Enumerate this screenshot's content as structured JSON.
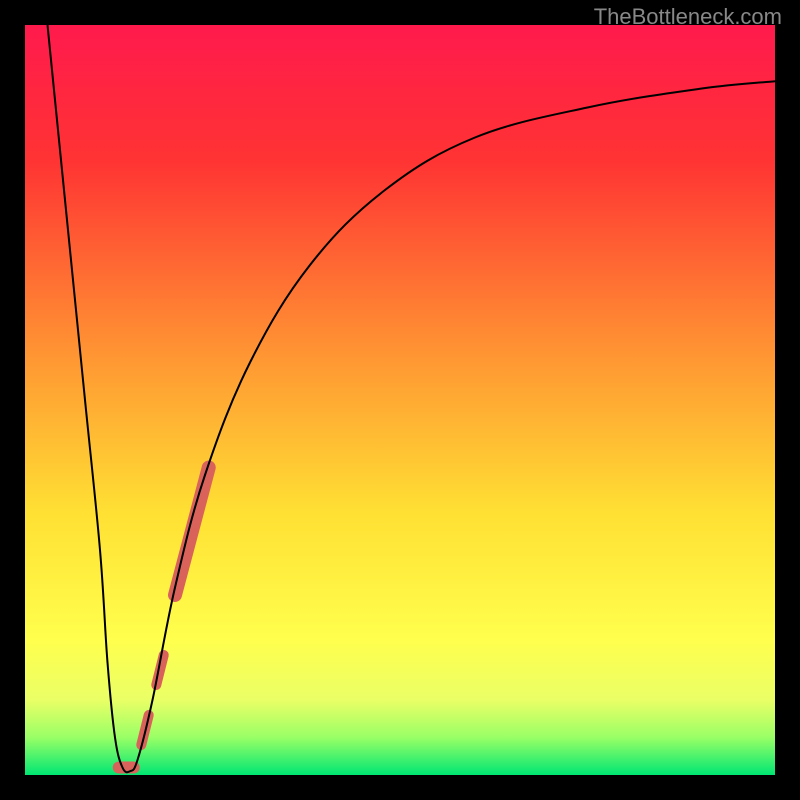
{
  "watermark": "TheBottleneck.com",
  "chart_data": {
    "type": "line",
    "title": "",
    "xlabel": "",
    "ylabel": "",
    "xlim": [
      0,
      100
    ],
    "ylim": [
      0,
      100
    ],
    "background": {
      "type": "vertical-gradient",
      "stops": [
        {
          "offset": 0.0,
          "color": "#ff1a4d"
        },
        {
          "offset": 0.18,
          "color": "#ff3333"
        },
        {
          "offset": 0.45,
          "color": "#ff9933"
        },
        {
          "offset": 0.65,
          "color": "#ffe033"
        },
        {
          "offset": 0.82,
          "color": "#ffff4d"
        },
        {
          "offset": 0.9,
          "color": "#eaff66"
        },
        {
          "offset": 0.95,
          "color": "#99ff66"
        },
        {
          "offset": 1.0,
          "color": "#00e673"
        }
      ]
    },
    "series": [
      {
        "name": "bottleneck-curve",
        "color": "#000000",
        "stroke_width": 2,
        "points": [
          {
            "x": 3,
            "y": 100
          },
          {
            "x": 4,
            "y": 90
          },
          {
            "x": 6,
            "y": 70
          },
          {
            "x": 8,
            "y": 50
          },
          {
            "x": 10,
            "y": 30
          },
          {
            "x": 11,
            "y": 15
          },
          {
            "x": 12,
            "y": 5
          },
          {
            "x": 13,
            "y": 1
          },
          {
            "x": 14,
            "y": 0.5
          },
          {
            "x": 15,
            "y": 2
          },
          {
            "x": 17,
            "y": 10
          },
          {
            "x": 20,
            "y": 25
          },
          {
            "x": 24,
            "y": 40
          },
          {
            "x": 30,
            "y": 55
          },
          {
            "x": 38,
            "y": 68
          },
          {
            "x": 48,
            "y": 78
          },
          {
            "x": 60,
            "y": 85
          },
          {
            "x": 75,
            "y": 89
          },
          {
            "x": 90,
            "y": 91.5
          },
          {
            "x": 100,
            "y": 92.5
          }
        ]
      }
    ],
    "highlights": [
      {
        "name": "highlight-segment-upper",
        "color": "#d9635a",
        "stroke_width": 14,
        "linecap": "round",
        "points": [
          {
            "x": 20,
            "y": 24
          },
          {
            "x": 24.5,
            "y": 41
          }
        ]
      },
      {
        "name": "highlight-dot-mid",
        "color": "#d9635a",
        "stroke_width": 10,
        "linecap": "round",
        "points": [
          {
            "x": 17.5,
            "y": 12
          },
          {
            "x": 18.5,
            "y": 16
          }
        ]
      },
      {
        "name": "highlight-dot-lower",
        "color": "#d9635a",
        "stroke_width": 10,
        "linecap": "round",
        "points": [
          {
            "x": 15.5,
            "y": 4
          },
          {
            "x": 16.5,
            "y": 8
          }
        ]
      },
      {
        "name": "highlight-dot-bottom",
        "color": "#d9635a",
        "stroke_width": 12,
        "linecap": "round",
        "points": [
          {
            "x": 12.5,
            "y": 1
          },
          {
            "x": 14.5,
            "y": 1
          }
        ]
      }
    ]
  }
}
